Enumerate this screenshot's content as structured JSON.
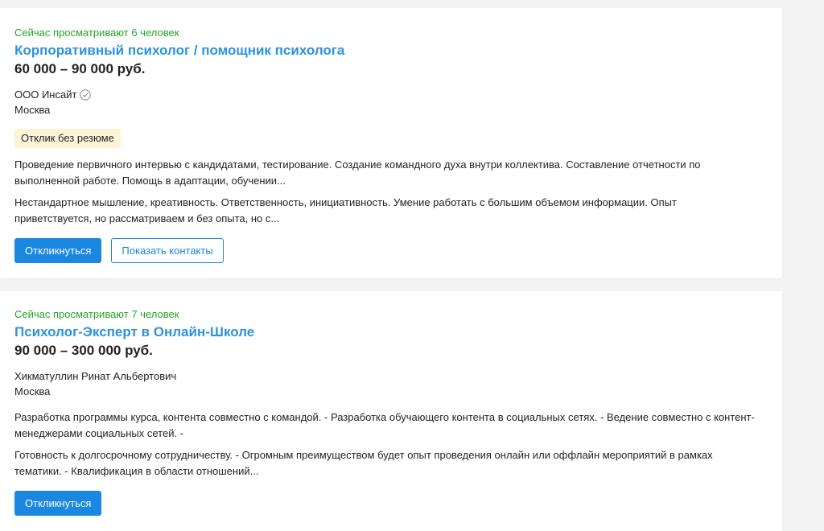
{
  "vacancies": [
    {
      "viewers": "Сейчас просматривают 6 человек",
      "title": "Корпоративный психолог / помощник психолога",
      "salary": "60 000 – 90 000 руб.",
      "company": "ООО Инсайт",
      "verified_icon": "check-circle-icon",
      "city": "Москва",
      "badge": "Отклик без резюме",
      "responsibilities": "Проведение первичного интервью с кандидатами, тестирование. Создание командного духа внутри коллектива. Составление отчетности по выполненной работе. Помощь в адаптации, обучении...",
      "requirements": "Нестандартное мышление, креативность. Ответственность, инициативность. Умение работать с большим объемом информации. Опыт приветствуется, но рассматриваем и без опыта, но с...",
      "respond_label": "Откликнуться",
      "contacts_label": "Показать контакты"
    },
    {
      "viewers": "Сейчас просматривают 7 человек",
      "title": "Психолог-Эксперт в Онлайн-Школе",
      "salary": "90 000 – 300 000 руб.",
      "company": "Хикматуллин Ринат Альбертович",
      "city": "Москва",
      "responsibilities": "Разработка программы курса, контента совместно с командой. - Разработка обучающего контента в социальных сетях. - Ведение совместно с контент-менеджерами социальных сетей. -",
      "requirements": "Готовность к долгосрочному сотрудничеству. - Огромным преимуществом будет опыт проведения онлайн или оффлайн мероприятий в рамках тематики. - Квалификация в области отношений...",
      "respond_label": "Откликнуться"
    }
  ],
  "colors": {
    "title": "#2d92e0",
    "viewers": "#28a428",
    "button": "#1a87e0",
    "badge_bg": "#fdf4d7"
  }
}
